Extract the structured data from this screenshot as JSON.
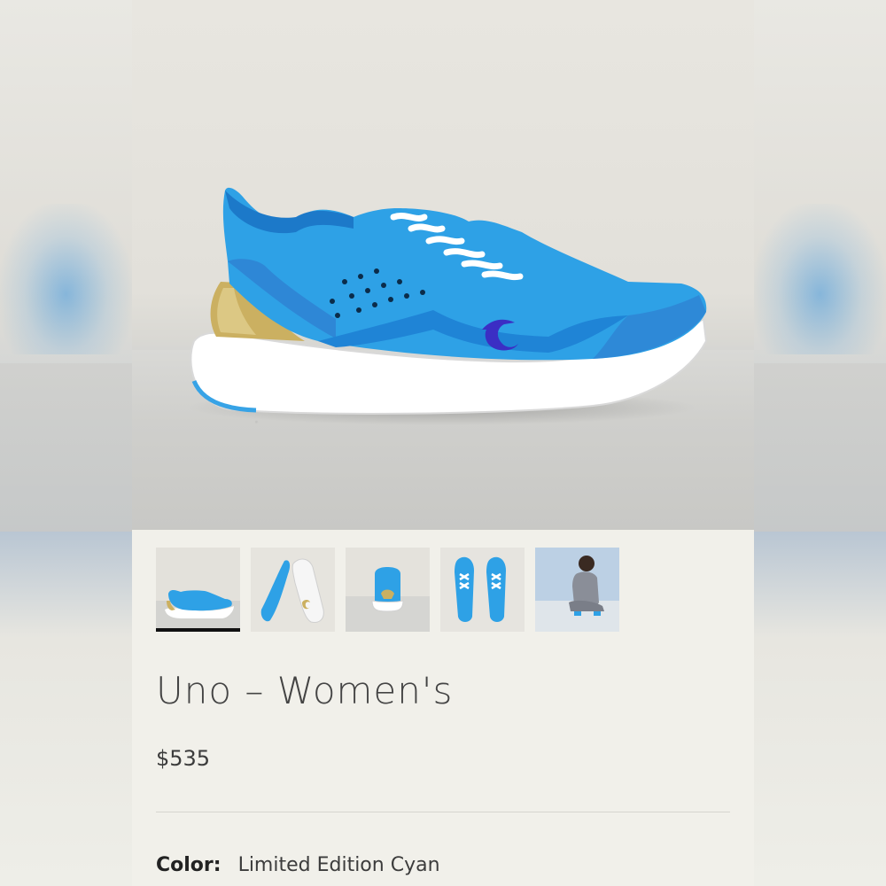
{
  "product": {
    "title": "Uno – Women's",
    "price": "$535",
    "color_label": "Color:",
    "color_value": "Limited Edition Cyan"
  },
  "gallery": {
    "active_index": 0,
    "thumbnails": [
      {
        "name": "side-view"
      },
      {
        "name": "pair-sole-view"
      },
      {
        "name": "back-view"
      },
      {
        "name": "top-view"
      },
      {
        "name": "lifestyle-model"
      }
    ]
  },
  "colors": {
    "accent_blue": "#2b9be0",
    "sole_white": "#ffffff",
    "heel_gold": "#c9a948",
    "logo_navy": "#3b2ec4",
    "page_bg": "#f1f0ea"
  }
}
